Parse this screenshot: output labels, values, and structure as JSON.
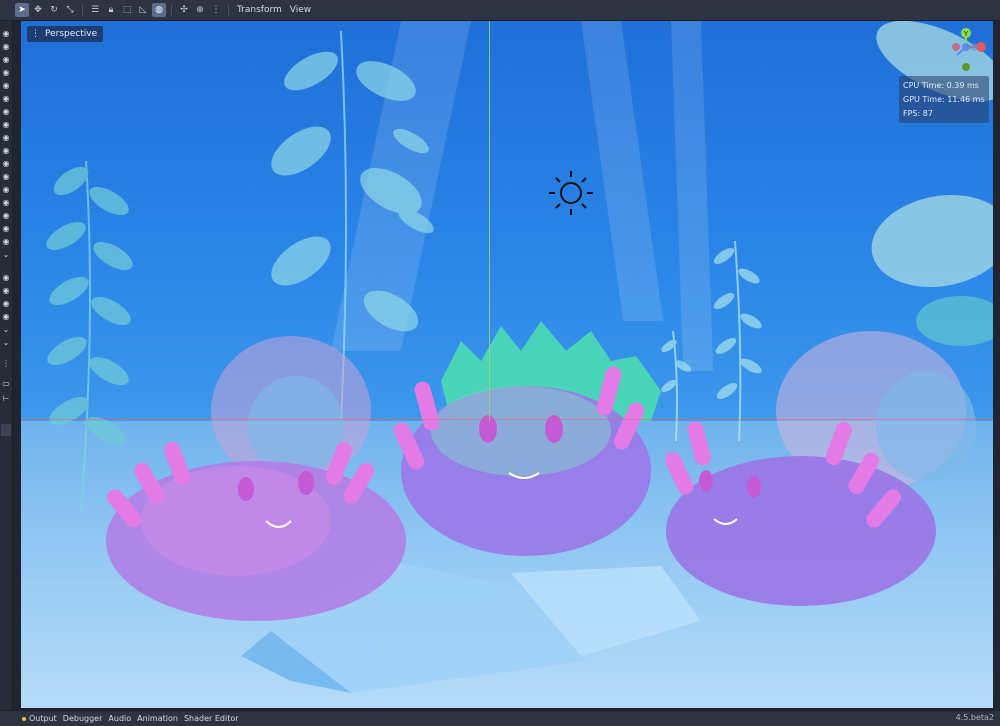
{
  "toolbar": {
    "icons": [
      "select-tool-icon",
      "move-tool-icon",
      "rotate-tool-icon",
      "scale-tool-icon",
      "list-icon",
      "lock-icon",
      "group-icon",
      "ruler-icon",
      "local-space-icon",
      "snap-icon",
      "grid-icon",
      "more-icon"
    ],
    "menus": [
      "Transform",
      "View"
    ]
  },
  "viewport": {
    "mode_label": "Perspective"
  },
  "stats": {
    "cpu": "CPU Time: 0.39 ms",
    "gpu": "GPU Time: 11.46 ms",
    "fps": "FPS: 87"
  },
  "gizmo": {
    "axis_y": "Y"
  },
  "bottom": {
    "tabs": [
      "Output",
      "Debugger",
      "Audio",
      "Animation",
      "Shader Editor"
    ],
    "version": "4.5.beta2"
  },
  "colors": {
    "background_blue": "#2b86e8",
    "editor_bg": "#2d3341",
    "slime_pink": "#e27be6",
    "slime_purple": "#8a66e3",
    "stat_value": "#d9f4a6"
  }
}
